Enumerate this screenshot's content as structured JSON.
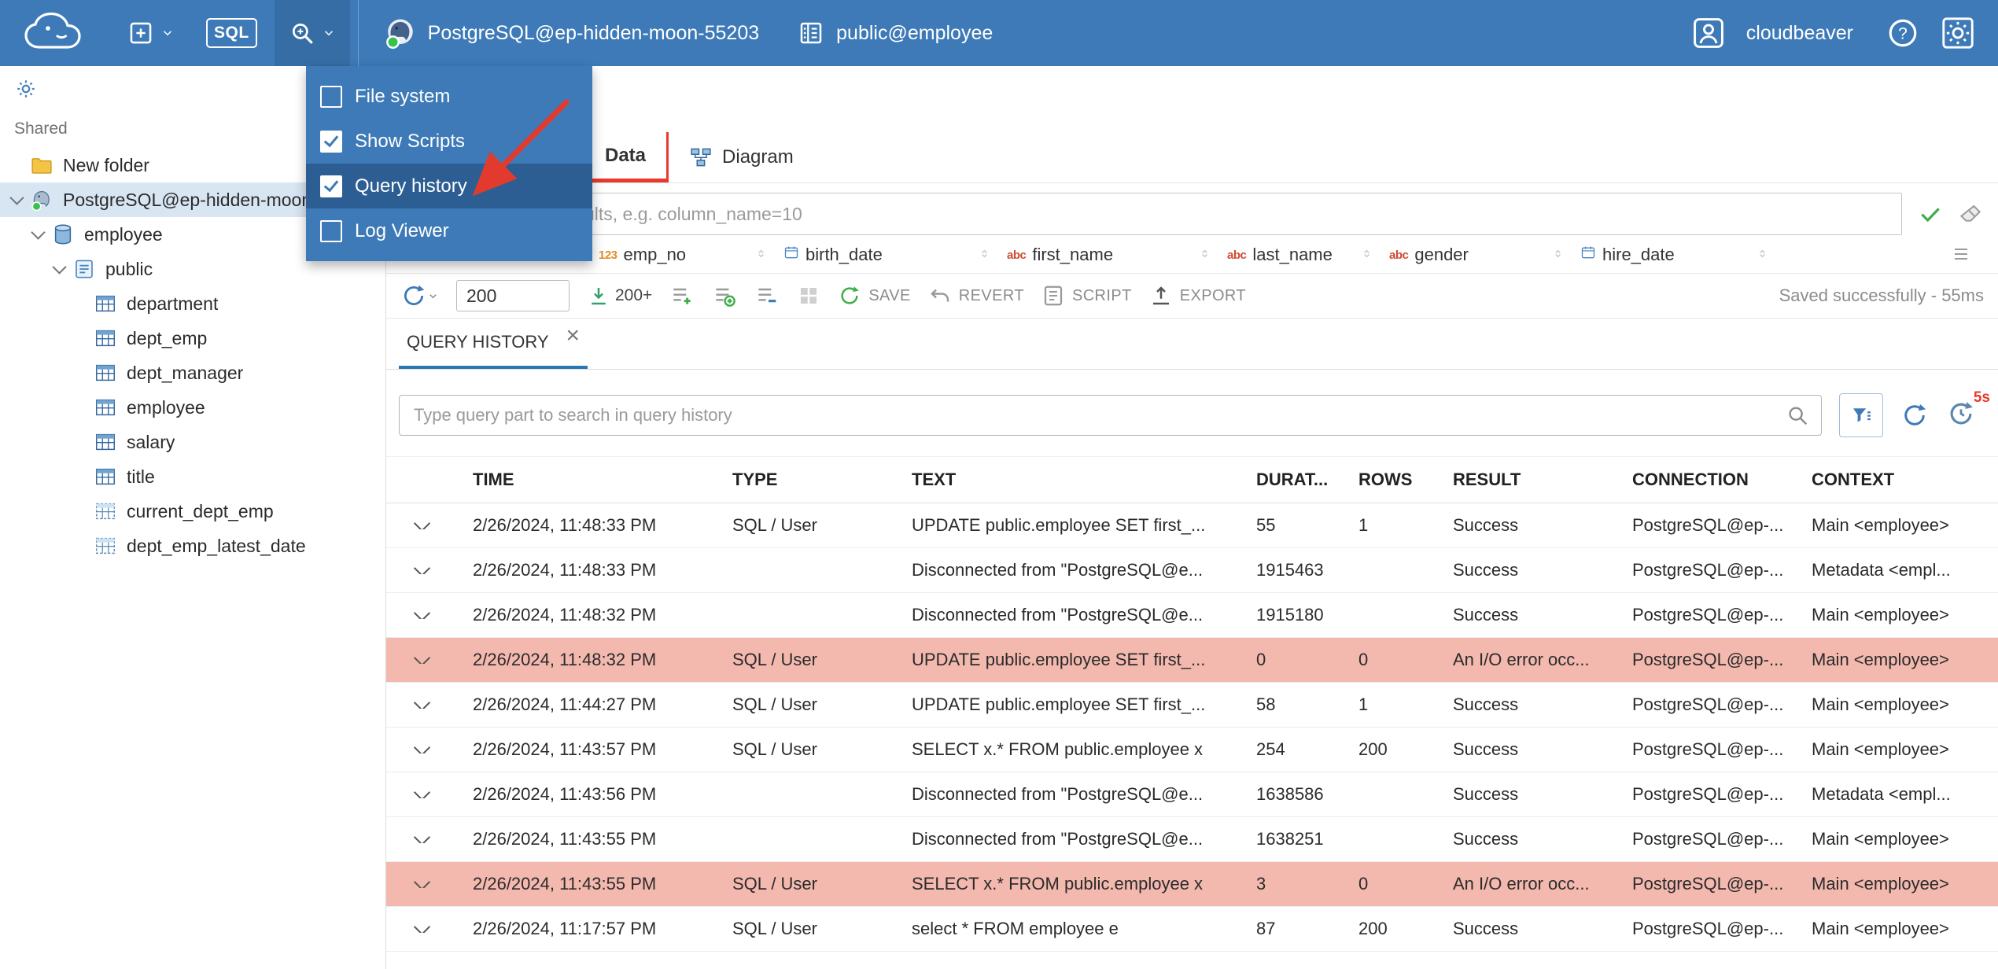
{
  "topbar": {
    "logo_title": "CloudBeaver",
    "sql_button": "SQL",
    "connection_label": "PostgreSQL@ep-hidden-moon-55203",
    "schema_label": "public@employee",
    "username": "cloudbeaver"
  },
  "tools_menu": {
    "items": [
      {
        "label": "File system",
        "checked": false,
        "selected": false
      },
      {
        "label": "Show Scripts",
        "checked": true,
        "selected": false
      },
      {
        "label": "Query history",
        "checked": true,
        "selected": true
      },
      {
        "label": "Log Viewer",
        "checked": false,
        "selected": false
      }
    ]
  },
  "sidebar": {
    "section_label": "Shared",
    "tree": [
      {
        "label": "New folder",
        "icon": "folder",
        "indent": 0,
        "expanded": false,
        "selected": false
      },
      {
        "label": "PostgreSQL@ep-hidden-moon-55203",
        "icon": "postgres",
        "indent": 0,
        "expanded": true,
        "selected": true
      },
      {
        "label": "employee",
        "icon": "database",
        "indent": 1,
        "expanded": true,
        "selected": false
      },
      {
        "label": "public",
        "icon": "schema",
        "indent": 2,
        "expanded": true,
        "selected": false
      },
      {
        "label": "department",
        "icon": "table",
        "indent": 3,
        "expanded": false,
        "selected": false
      },
      {
        "label": "dept_emp",
        "icon": "table",
        "indent": 3,
        "expanded": false,
        "selected": false
      },
      {
        "label": "dept_manager",
        "icon": "table",
        "indent": 3,
        "expanded": false,
        "selected": false
      },
      {
        "label": "employee",
        "icon": "table",
        "indent": 3,
        "expanded": false,
        "selected": false
      },
      {
        "label": "salary",
        "icon": "table",
        "indent": 3,
        "expanded": false,
        "selected": false
      },
      {
        "label": "title",
        "icon": "table",
        "indent": 3,
        "expanded": false,
        "selected": false
      },
      {
        "label": "current_dept_emp",
        "icon": "view",
        "indent": 3,
        "expanded": false,
        "selected": false
      },
      {
        "label": "dept_emp_latest_date",
        "icon": "view",
        "indent": 3,
        "expanded": false,
        "selected": false
      }
    ]
  },
  "editor": {
    "tabs": [
      {
        "label": "Data",
        "active": true
      },
      {
        "label": "Diagram",
        "active": false
      }
    ],
    "filter_placeholder": "expression to filter results, e.g. column_name=10",
    "grid_columns": [
      {
        "name": "emp_no",
        "type": "number"
      },
      {
        "name": "birth_date",
        "type": "date"
      },
      {
        "name": "first_name",
        "type": "string"
      },
      {
        "name": "last_name",
        "type": "string"
      },
      {
        "name": "gender",
        "type": "string"
      },
      {
        "name": "hire_date",
        "type": "date"
      }
    ],
    "toolbar": {
      "row_limit": "200",
      "fetch_more_label": "200+",
      "save_label": "SAVE",
      "revert_label": "REVERT",
      "script_label": "SCRIPT",
      "export_label": "EXPORT",
      "status": "Saved successfully - 55ms"
    }
  },
  "query_history": {
    "tab_label": "QUERY HISTORY",
    "search_placeholder": "Type query part to search in query history",
    "auto_refresh_badge": "5s",
    "columns": [
      "TIME",
      "TYPE",
      "TEXT",
      "DURAT...",
      "ROWS",
      "RESULT",
      "CONNECTION",
      "CONTEXT"
    ],
    "rows": [
      {
        "time": "2/26/2024, 11:48:33 PM",
        "type": "SQL / User",
        "text": "UPDATE public.employee SET first_...",
        "duration": "55",
        "rows": "1",
        "result": "Success",
        "connection": "PostgreSQL@ep-...",
        "context": "Main <employee>",
        "error": false
      },
      {
        "time": "2/26/2024, 11:48:33 PM",
        "type": "",
        "text": "Disconnected from \"PostgreSQL@e...",
        "duration": "1915463",
        "rows": "",
        "result": "Success",
        "connection": "PostgreSQL@ep-...",
        "context": "Metadata <empl...",
        "error": false
      },
      {
        "time": "2/26/2024, 11:48:32 PM",
        "type": "",
        "text": "Disconnected from \"PostgreSQL@e...",
        "duration": "1915180",
        "rows": "",
        "result": "Success",
        "connection": "PostgreSQL@ep-...",
        "context": "Main <employee>",
        "error": false
      },
      {
        "time": "2/26/2024, 11:48:32 PM",
        "type": "SQL / User",
        "text": "UPDATE public.employee SET first_...",
        "duration": "0",
        "rows": "0",
        "result": "An I/O error occ...",
        "connection": "PostgreSQL@ep-...",
        "context": "Main <employee>",
        "error": true
      },
      {
        "time": "2/26/2024, 11:44:27 PM",
        "type": "SQL / User",
        "text": "UPDATE public.employee SET first_...",
        "duration": "58",
        "rows": "1",
        "result": "Success",
        "connection": "PostgreSQL@ep-...",
        "context": "Main <employee>",
        "error": false
      },
      {
        "time": "2/26/2024, 11:43:57 PM",
        "type": "SQL / User",
        "text": "SELECT x.* FROM public.employee x",
        "duration": "254",
        "rows": "200",
        "result": "Success",
        "connection": "PostgreSQL@ep-...",
        "context": "Main <employee>",
        "error": false
      },
      {
        "time": "2/26/2024, 11:43:56 PM",
        "type": "",
        "text": "Disconnected from \"PostgreSQL@e...",
        "duration": "1638586",
        "rows": "",
        "result": "Success",
        "connection": "PostgreSQL@ep-...",
        "context": "Metadata <empl...",
        "error": false
      },
      {
        "time": "2/26/2024, 11:43:55 PM",
        "type": "",
        "text": "Disconnected from \"PostgreSQL@e...",
        "duration": "1638251",
        "rows": "",
        "result": "Success",
        "connection": "PostgreSQL@ep-...",
        "context": "Main <employee>",
        "error": false
      },
      {
        "time": "2/26/2024, 11:43:55 PM",
        "type": "SQL / User",
        "text": "SELECT x.* FROM public.employee x",
        "duration": "3",
        "rows": "0",
        "result": "An I/O error occ...",
        "connection": "PostgreSQL@ep-...",
        "context": "Main <employee>",
        "error": true
      },
      {
        "time": "2/26/2024, 11:17:57 PM",
        "type": "SQL / User",
        "text": "select * FROM employee e",
        "duration": "87",
        "rows": "200",
        "result": "Success",
        "connection": "PostgreSQL@ep-...",
        "context": "Main <employee>",
        "error": false
      }
    ]
  },
  "colors": {
    "topbar_blue": "#3d7ab7",
    "menu_selected_blue": "#2c5e93",
    "active_tab_red": "#e8392e",
    "history_tab_underline": "#2878b5",
    "error_row_bg": "#f3b8ae",
    "success_green": "#43a047"
  }
}
